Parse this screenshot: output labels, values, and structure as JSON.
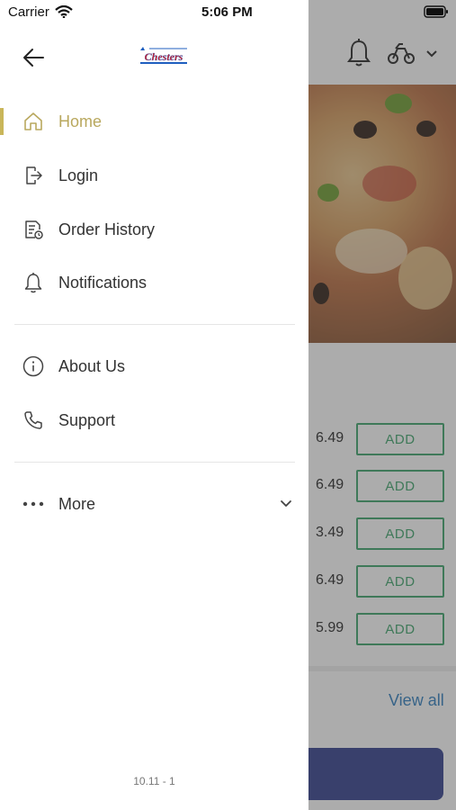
{
  "status_bar": {
    "carrier": "Carrier",
    "time": "5:06 PM"
  },
  "drawer": {
    "logo_text": "Chesters",
    "menu_items": [
      {
        "label": "Home",
        "icon": "home-icon",
        "active": true
      },
      {
        "label": "Login",
        "icon": "login-icon",
        "active": false
      },
      {
        "label": "Order History",
        "icon": "order-history-icon",
        "active": false
      },
      {
        "label": "Notifications",
        "icon": "bell-icon",
        "active": false
      },
      {
        "label": "About Us",
        "icon": "info-icon",
        "active": false
      },
      {
        "label": "Support",
        "icon": "phone-icon",
        "active": false
      },
      {
        "label": "More",
        "icon": "more-dots-icon",
        "active": false
      }
    ],
    "version": "10.11 - 1"
  },
  "background": {
    "items": [
      {
        "price": "6.49",
        "button": "ADD"
      },
      {
        "price": "6.49",
        "button": "ADD"
      },
      {
        "price": "3.49",
        "button": "ADD"
      },
      {
        "price": "6.49",
        "button": "ADD"
      },
      {
        "price": "5.99",
        "button": "ADD"
      }
    ],
    "view_all": "View all"
  },
  "colors": {
    "accent": "#c9b65a",
    "add_button": "#3aa368",
    "link": "#2a7bbd",
    "cart_bar": "#2f3b8a"
  }
}
